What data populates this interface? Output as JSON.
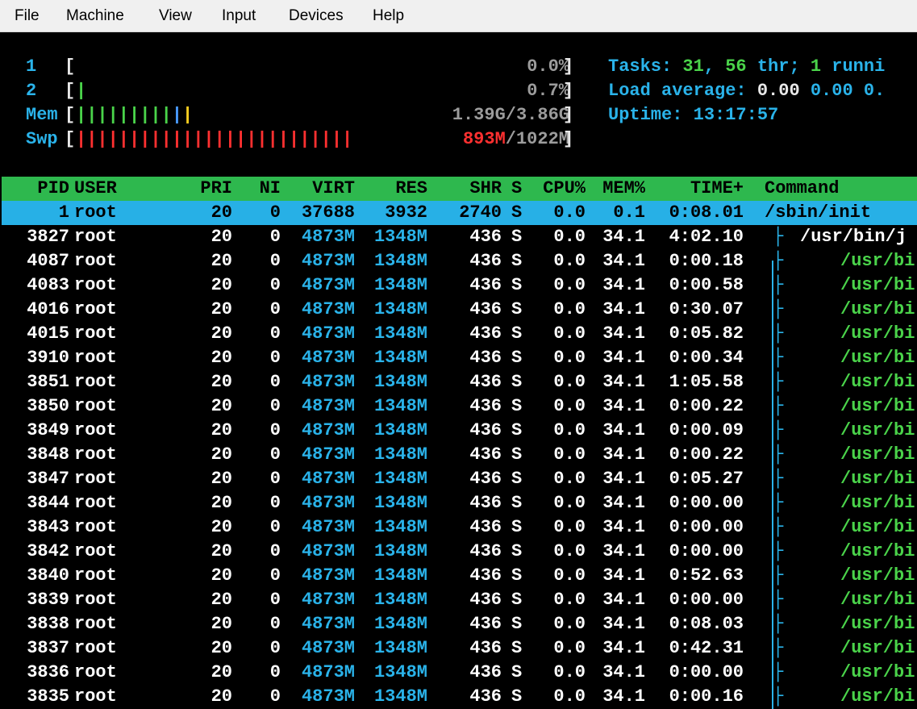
{
  "menu": {
    "items": [
      {
        "label": "File"
      },
      {
        "label": "Machine"
      },
      {
        "label": "View"
      },
      {
        "label": "Input"
      },
      {
        "label": "Devices"
      },
      {
        "label": "Help"
      }
    ]
  },
  "meters": {
    "cpu1": {
      "label": "1",
      "value": "0.0%",
      "fraction": 0.0
    },
    "cpu2": {
      "label": "2",
      "value": "0.7%",
      "fraction": 0.007
    },
    "mem": {
      "label": "Mem",
      "used": "1.39G",
      "total": "3.86G",
      "fraction": 0.36
    },
    "swp": {
      "label": "Swp",
      "used": "893M",
      "total": "1022M",
      "fraction": 0.87
    }
  },
  "summary": {
    "tasks_label": "Tasks: ",
    "tasks": "31",
    "threads": "56",
    "thr_label": " thr; ",
    "running": "1",
    "running_label": " runni",
    "load_label": "Load average: ",
    "load1": "0.00",
    "load5": "0.00",
    "load15": "0.",
    "uptime_label": "Uptime: ",
    "uptime": "13:17:57"
  },
  "columns": [
    "PID",
    "USER",
    "PRI",
    "NI",
    "VIRT",
    "RES",
    "SHR",
    "S",
    "CPU%",
    "MEM%",
    "TIME+",
    "Command"
  ],
  "processes": [
    {
      "pid": "1",
      "user": "root",
      "pri": "20",
      "ni": "0",
      "virt": "37688",
      "res": "3932",
      "shr": "2740",
      "s": "S",
      "cpu": "0.0",
      "mem": "0.1",
      "time": "0:08.01",
      "tree": "",
      "command": "/sbin/init",
      "selected": true
    },
    {
      "pid": "3827",
      "user": "root",
      "pri": "20",
      "ni": "0",
      "virt": "4873M",
      "res": "1348M",
      "shr": "436",
      "s": "S",
      "cpu": "0.0",
      "mem": "34.1",
      "time": "4:02.10",
      "tree": "├ ",
      "command": "/usr/bin/j"
    },
    {
      "pid": "4087",
      "user": "root",
      "pri": "20",
      "ni": "0",
      "virt": "4873M",
      "res": "1348M",
      "shr": "436",
      "s": "S",
      "cpu": "0.0",
      "mem": "34.1",
      "time": "0:00.18",
      "tree": "├ ",
      "command": "/usr/bi"
    },
    {
      "pid": "4083",
      "user": "root",
      "pri": "20",
      "ni": "0",
      "virt": "4873M",
      "res": "1348M",
      "shr": "436",
      "s": "S",
      "cpu": "0.0",
      "mem": "34.1",
      "time": "0:00.58",
      "tree": "├ ",
      "command": "/usr/bi"
    },
    {
      "pid": "4016",
      "user": "root",
      "pri": "20",
      "ni": "0",
      "virt": "4873M",
      "res": "1348M",
      "shr": "436",
      "s": "S",
      "cpu": "0.0",
      "mem": "34.1",
      "time": "0:30.07",
      "tree": "├ ",
      "command": "/usr/bi"
    },
    {
      "pid": "4015",
      "user": "root",
      "pri": "20",
      "ni": "0",
      "virt": "4873M",
      "res": "1348M",
      "shr": "436",
      "s": "S",
      "cpu": "0.0",
      "mem": "34.1",
      "time": "0:05.82",
      "tree": "├ ",
      "command": "/usr/bi"
    },
    {
      "pid": "3910",
      "user": "root",
      "pri": "20",
      "ni": "0",
      "virt": "4873M",
      "res": "1348M",
      "shr": "436",
      "s": "S",
      "cpu": "0.0",
      "mem": "34.1",
      "time": "0:00.34",
      "tree": "├ ",
      "command": "/usr/bi"
    },
    {
      "pid": "3851",
      "user": "root",
      "pri": "20",
      "ni": "0",
      "virt": "4873M",
      "res": "1348M",
      "shr": "436",
      "s": "S",
      "cpu": "0.0",
      "mem": "34.1",
      "time": "1:05.58",
      "tree": "├ ",
      "command": "/usr/bi"
    },
    {
      "pid": "3850",
      "user": "root",
      "pri": "20",
      "ni": "0",
      "virt": "4873M",
      "res": "1348M",
      "shr": "436",
      "s": "S",
      "cpu": "0.0",
      "mem": "34.1",
      "time": "0:00.22",
      "tree": "├ ",
      "command": "/usr/bi"
    },
    {
      "pid": "3849",
      "user": "root",
      "pri": "20",
      "ni": "0",
      "virt": "4873M",
      "res": "1348M",
      "shr": "436",
      "s": "S",
      "cpu": "0.0",
      "mem": "34.1",
      "time": "0:00.09",
      "tree": "├ ",
      "command": "/usr/bi"
    },
    {
      "pid": "3848",
      "user": "root",
      "pri": "20",
      "ni": "0",
      "virt": "4873M",
      "res": "1348M",
      "shr": "436",
      "s": "S",
      "cpu": "0.0",
      "mem": "34.1",
      "time": "0:00.22",
      "tree": "├ ",
      "command": "/usr/bi"
    },
    {
      "pid": "3847",
      "user": "root",
      "pri": "20",
      "ni": "0",
      "virt": "4873M",
      "res": "1348M",
      "shr": "436",
      "s": "S",
      "cpu": "0.0",
      "mem": "34.1",
      "time": "0:05.27",
      "tree": "├ ",
      "command": "/usr/bi"
    },
    {
      "pid": "3844",
      "user": "root",
      "pri": "20",
      "ni": "0",
      "virt": "4873M",
      "res": "1348M",
      "shr": "436",
      "s": "S",
      "cpu": "0.0",
      "mem": "34.1",
      "time": "0:00.00",
      "tree": "├ ",
      "command": "/usr/bi"
    },
    {
      "pid": "3843",
      "user": "root",
      "pri": "20",
      "ni": "0",
      "virt": "4873M",
      "res": "1348M",
      "shr": "436",
      "s": "S",
      "cpu": "0.0",
      "mem": "34.1",
      "time": "0:00.00",
      "tree": "├ ",
      "command": "/usr/bi"
    },
    {
      "pid": "3842",
      "user": "root",
      "pri": "20",
      "ni": "0",
      "virt": "4873M",
      "res": "1348M",
      "shr": "436",
      "s": "S",
      "cpu": "0.0",
      "mem": "34.1",
      "time": "0:00.00",
      "tree": "├ ",
      "command": "/usr/bi"
    },
    {
      "pid": "3840",
      "user": "root",
      "pri": "20",
      "ni": "0",
      "virt": "4873M",
      "res": "1348M",
      "shr": "436",
      "s": "S",
      "cpu": "0.0",
      "mem": "34.1",
      "time": "0:52.63",
      "tree": "├ ",
      "command": "/usr/bi"
    },
    {
      "pid": "3839",
      "user": "root",
      "pri": "20",
      "ni": "0",
      "virt": "4873M",
      "res": "1348M",
      "shr": "436",
      "s": "S",
      "cpu": "0.0",
      "mem": "34.1",
      "time": "0:00.00",
      "tree": "├ ",
      "command": "/usr/bi"
    },
    {
      "pid": "3838",
      "user": "root",
      "pri": "20",
      "ni": "0",
      "virt": "4873M",
      "res": "1348M",
      "shr": "436",
      "s": "S",
      "cpu": "0.0",
      "mem": "34.1",
      "time": "0:08.03",
      "tree": "├ ",
      "command": "/usr/bi"
    },
    {
      "pid": "3837",
      "user": "root",
      "pri": "20",
      "ni": "0",
      "virt": "4873M",
      "res": "1348M",
      "shr": "436",
      "s": "S",
      "cpu": "0.0",
      "mem": "34.1",
      "time": "0:42.31",
      "tree": "├ ",
      "command": "/usr/bi"
    },
    {
      "pid": "3836",
      "user": "root",
      "pri": "20",
      "ni": "0",
      "virt": "4873M",
      "res": "1348M",
      "shr": "436",
      "s": "S",
      "cpu": "0.0",
      "mem": "34.1",
      "time": "0:00.00",
      "tree": "├ ",
      "command": "/usr/bi"
    },
    {
      "pid": "3835",
      "user": "root",
      "pri": "20",
      "ni": "0",
      "virt": "4873M",
      "res": "1348M",
      "shr": "436",
      "s": "S",
      "cpu": "0.0",
      "mem": "34.1",
      "time": "0:00.16",
      "tree": "├ ",
      "command": "/usr/bi"
    }
  ],
  "colors": {
    "header_bg": "#2eb84e",
    "selected_bg": "#27b0e6",
    "cyan": "#2ab3ea",
    "green": "#4ad34a",
    "swap_red": "#ff3030",
    "mem_yellow": "#ffd020"
  }
}
